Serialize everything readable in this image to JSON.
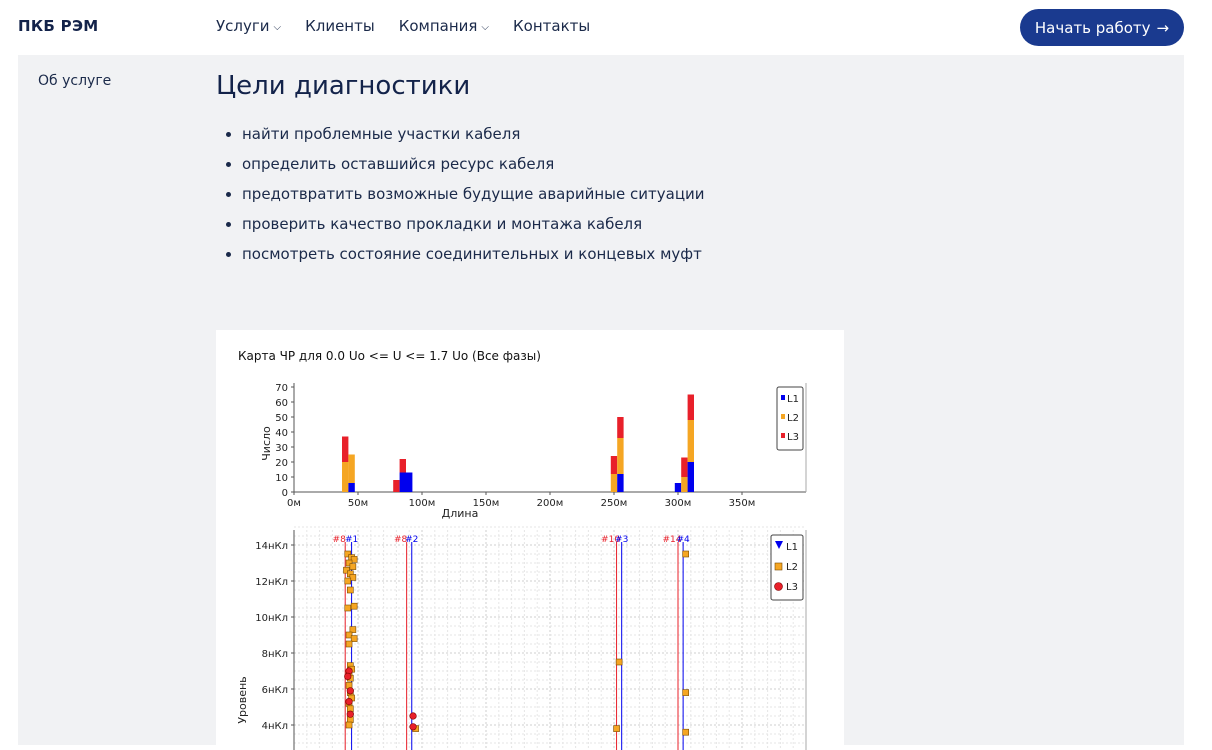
{
  "nav": {
    "logo": "ПКБ РЭМ",
    "items": [
      {
        "label": "Услуги",
        "has_dropdown": true
      },
      {
        "label": "Клиенты",
        "has_dropdown": false
      },
      {
        "label": "Компания",
        "has_dropdown": true
      },
      {
        "label": "Контакты",
        "has_dropdown": false
      }
    ],
    "cta_label": "Начать работу",
    "cta_icon": "arrow-right-icon"
  },
  "sidebar": {
    "link": "Об услуге"
  },
  "main": {
    "heading": "Цели диагностики",
    "goals": [
      "найти проблемные участки кабеля",
      "определить оставшийся ресурс кабеля",
      "предотвратить возможные будущие аварийные ситуации",
      "проверить качество прокладки и монтажа кабеля",
      "посмотреть состояние соединительных и концевых муфт"
    ]
  },
  "colors": {
    "accent": "#1a3a8f",
    "panel_bg": "#f1f2f4",
    "L1": "#0000ee",
    "L2": "#f5a623",
    "L3": "#e8202a"
  },
  "chart_data": [
    {
      "type": "bar",
      "title": "Карта ЧР для 0.0 Uo <= U <= 1.7 Uo (Все фазы)",
      "xlabel": "Длина",
      "ylabel": "Число",
      "xlim": [
        0,
        400
      ],
      "ylim": [
        0,
        70
      ],
      "xticks": [
        "0м",
        "50м",
        "100м",
        "150м",
        "200м",
        "250м",
        "300м",
        "350м"
      ],
      "yticks": [
        "0",
        "10",
        "20",
        "30",
        "40",
        "50",
        "60",
        "70"
      ],
      "legend": [
        "L1",
        "L2",
        "L3"
      ],
      "legend_position": "top-right",
      "stacked": true,
      "bins": [
        {
          "x": 40,
          "L1": 0,
          "L2": 20,
          "L3": 17
        },
        {
          "x": 45,
          "L1": 6,
          "L2": 19,
          "L3": 0
        },
        {
          "x": 80,
          "L1": 0,
          "L2": 0,
          "L3": 8
        },
        {
          "x": 85,
          "L1": 13,
          "L2": 0,
          "L3": 9
        },
        {
          "x": 90,
          "L1": 13,
          "L2": 0,
          "L3": 0
        },
        {
          "x": 250,
          "L1": 0,
          "L2": 12,
          "L3": 12
        },
        {
          "x": 255,
          "L1": 12,
          "L2": 24,
          "L3": 14
        },
        {
          "x": 300,
          "L1": 6,
          "L2": 0,
          "L3": 0
        },
        {
          "x": 305,
          "L1": 0,
          "L2": 10,
          "L3": 13
        },
        {
          "x": 310,
          "L1": 20,
          "L2": 28,
          "L3": 17
        }
      ]
    },
    {
      "type": "scatter",
      "ylabel": "Уровень",
      "xlim": [
        0,
        400
      ],
      "yticks": [
        "4нКл",
        "6нКл",
        "8нКл",
        "10нКл",
        "12нКл",
        "14нКл"
      ],
      "legend": [
        "L1",
        "L2",
        "L3"
      ],
      "legend_position": "top-right",
      "markers": [
        {
          "label": "#8",
          "x": 40,
          "color": "#e8202a"
        },
        {
          "label": "#1",
          "x": 45,
          "color": "#0000ee"
        },
        {
          "label": "#8",
          "x": 88,
          "color": "#e8202a"
        },
        {
          "label": "#2",
          "x": 92,
          "color": "#0000ee"
        },
        {
          "label": "#10",
          "x": 252,
          "color": "#e8202a"
        },
        {
          "label": "#3",
          "x": 256,
          "color": "#0000ee"
        },
        {
          "label": "#14",
          "x": 300,
          "color": "#e8202a"
        },
        {
          "label": "#4",
          "x": 304,
          "color": "#0000ee"
        }
      ],
      "series": [
        {
          "name": "L2",
          "points": [
            [
              42,
              13.5
            ],
            [
              45,
              13.3
            ],
            [
              47,
              13.2
            ],
            [
              43,
              13.0
            ],
            [
              46,
              12.8
            ],
            [
              41,
              12.6
            ],
            [
              44,
              12.4
            ],
            [
              46,
              12.2
            ],
            [
              42,
              12.0
            ],
            [
              44,
              11.5
            ],
            [
              42,
              10.5
            ],
            [
              47,
              10.6
            ],
            [
              46,
              9.3
            ],
            [
              43,
              9.0
            ],
            [
              47,
              8.8
            ],
            [
              43,
              8.5
            ],
            [
              44,
              7.3
            ],
            [
              45,
              7.1
            ],
            [
              43,
              6.9
            ],
            [
              44,
              6.6
            ],
            [
              43,
              6.2
            ],
            [
              44,
              5.8
            ],
            [
              45,
              5.5
            ],
            [
              43,
              5.2
            ],
            [
              44,
              4.9
            ],
            [
              44,
              4.3
            ],
            [
              43,
              4.0
            ],
            [
              95,
              3.8
            ],
            [
              252,
              3.8
            ],
            [
              254,
              7.5
            ],
            [
              306,
              13.5
            ],
            [
              306,
              5.8
            ],
            [
              306,
              3.6
            ]
          ]
        },
        {
          "name": "L3",
          "points": [
            [
              43,
              7.0
            ],
            [
              42,
              6.7
            ],
            [
              44,
              5.9
            ],
            [
              43,
              5.3
            ],
            [
              44,
              4.6
            ],
            [
              93,
              4.5
            ],
            [
              93,
              3.9
            ]
          ]
        }
      ]
    }
  ]
}
